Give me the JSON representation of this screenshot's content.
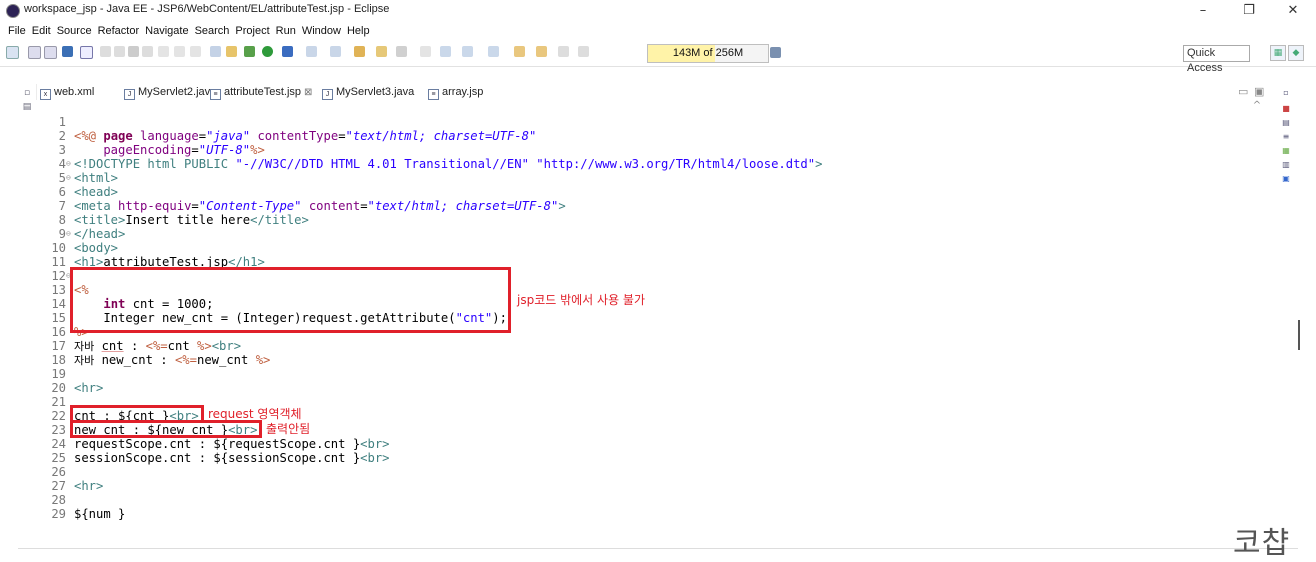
{
  "window": {
    "title": "workspace_jsp - Java EE - JSP6/WebContent/EL/attributeTest.jsp - Eclipse",
    "minimize": "–",
    "maximize": "❐",
    "close": "✕"
  },
  "menu": [
    "File",
    "Edit",
    "Source",
    "Refactor",
    "Navigate",
    "Search",
    "Project",
    "Run",
    "Window",
    "Help"
  ],
  "toolbar": {
    "heap_text": "143M of 256M",
    "heap_fraction": 0.56,
    "quick_access": "Quick Access"
  },
  "tabs": [
    {
      "label": "web.xml",
      "icon": "xml-file-icon"
    },
    {
      "label": "MyServlet2.java",
      "icon": "java-file-icon"
    },
    {
      "label": "attributeTest.jsp",
      "icon": "jsp-file-icon",
      "active": true,
      "close": "⊠"
    },
    {
      "label": "MyServlet3.java",
      "icon": "java-file-icon"
    },
    {
      "label": "array.jsp",
      "icon": "jsp-file-icon"
    }
  ],
  "code": {
    "l1": {
      "n": "1",
      "a": "<%@ ",
      "b": "page ",
      "c": "language",
      "d": "=",
      "e": "\"java\"",
      "f": " contentType",
      "g": "=",
      "h": "\"text/html; charset=UTF-8\""
    },
    "l2": {
      "n": "2",
      "a": "    pageEncoding",
      "b": "=",
      "c": "\"UTF-8\"",
      "d": "%>"
    },
    "l3": {
      "n": "3",
      "a": "<!DOCTYPE html PUBLIC ",
      "b": "\"-//W3C//DTD HTML 4.01 Transitional//EN\" \"http://www.w3.org/TR/html4/loose.dtd\"",
      "c": ">"
    },
    "l4": {
      "n": "4",
      "a": "<html>"
    },
    "l5": {
      "n": "5",
      "a": "<head>"
    },
    "l6": {
      "n": "6",
      "a": "<meta ",
      "b": "http-equiv",
      "c": "=",
      "d": "\"Content-Type\"",
      "e": " content",
      "f": "=",
      "g": "\"text/html; charset=UTF-8\"",
      "h": ">"
    },
    "l7": {
      "n": "7",
      "a": "<title>",
      "b": "Insert title here",
      "c": "</title>"
    },
    "l8": {
      "n": "8",
      "a": "</head>"
    },
    "l9": {
      "n": "9",
      "a": "<body>"
    },
    "l10": {
      "n": "10",
      "a": "<h1>",
      "b": "attributeTest.jsp",
      "c": "</h1>"
    },
    "l11": {
      "n": "11"
    },
    "l12": {
      "n": "12",
      "a": "<%"
    },
    "l13": {
      "n": "13",
      "a": "    ",
      "b": "int",
      "c": " cnt = 1000;"
    },
    "l14": {
      "n": "14",
      "a": "    Integer new_cnt = (Integer)request.getAttribute(",
      "b": "\"cnt\"",
      "c": ");"
    },
    "l15": {
      "n": "15",
      "a": "%>"
    },
    "l16": {
      "n": "16",
      "a": "자바",
      "b": " ",
      "c": "cnt",
      "d": " : ",
      "e": "<%=",
      "f": "cnt ",
      "g": "%>",
      "h": "<br>"
    },
    "l17": {
      "n": "17",
      "a": "자바",
      "b": " new_cnt : ",
      "c": "<%=",
      "d": "new_cnt ",
      "e": "%>"
    },
    "l18": {
      "n": "18"
    },
    "l19": {
      "n": "19",
      "a": "<hr>"
    },
    "l20": {
      "n": "20"
    },
    "l21": {
      "n": "21",
      "a": "cnt : ${cnt }",
      "b": "<br>"
    },
    "l22": {
      "n": "22",
      "a": "new_cnt : ${new_cnt }",
      "b": "<br>"
    },
    "l23": {
      "n": "23",
      "a": "requestScope.cnt : ${requestScope.cnt }",
      "b": "<br>"
    },
    "l24": {
      "n": "24",
      "a": "sessionScope.cnt : ${sessionScope.cnt }",
      "b": "<br>"
    },
    "l25": {
      "n": "25"
    },
    "l26": {
      "n": "26",
      "a": "<hr>"
    },
    "l27": {
      "n": "27"
    },
    "l28": {
      "n": "28",
      "a": "${num }"
    },
    "l29": {
      "n": "29"
    }
  },
  "annotations": {
    "scriptlet_note": "jsp코드 밖에서 사용 불가",
    "cnt_note": "request 영역객체",
    "new_cnt_note": "출력안됨"
  },
  "watermark": "코챱",
  "colors": {
    "annotation_red": "#e0202a",
    "keyword": "#7f0055",
    "tag": "#3f7f7f",
    "attribute": "#7f007f",
    "string": "#2a00ff",
    "jsp_delimiter": "#bf5f3f"
  }
}
